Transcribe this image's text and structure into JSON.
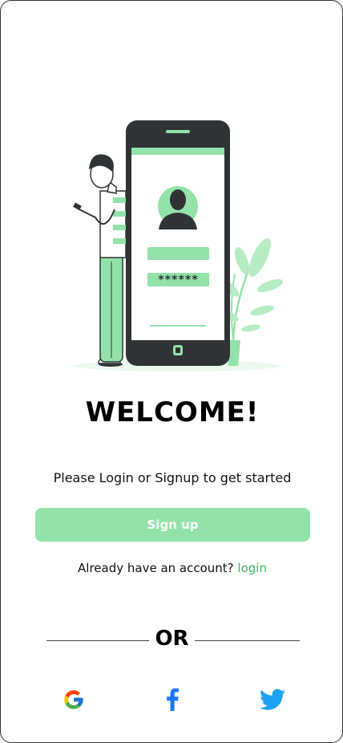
{
  "welcome": {
    "title": "WELCOME!",
    "subtitle": "Please Login or Signup to get started"
  },
  "illustration": {
    "password_mask": "******"
  },
  "actions": {
    "signup_label": "Sign up",
    "already_text": "Already have an account?",
    "login_label": "login"
  },
  "divider": {
    "or_label": "OR"
  },
  "social": {
    "icons": [
      "google-icon",
      "facebook-icon",
      "twitter-icon"
    ]
  },
  "colors": {
    "accent": "#93e2aa",
    "link": "#3db55e",
    "phone_dark": "#2f3336",
    "facebook": "#1877f2",
    "twitter": "#1da1f2"
  }
}
